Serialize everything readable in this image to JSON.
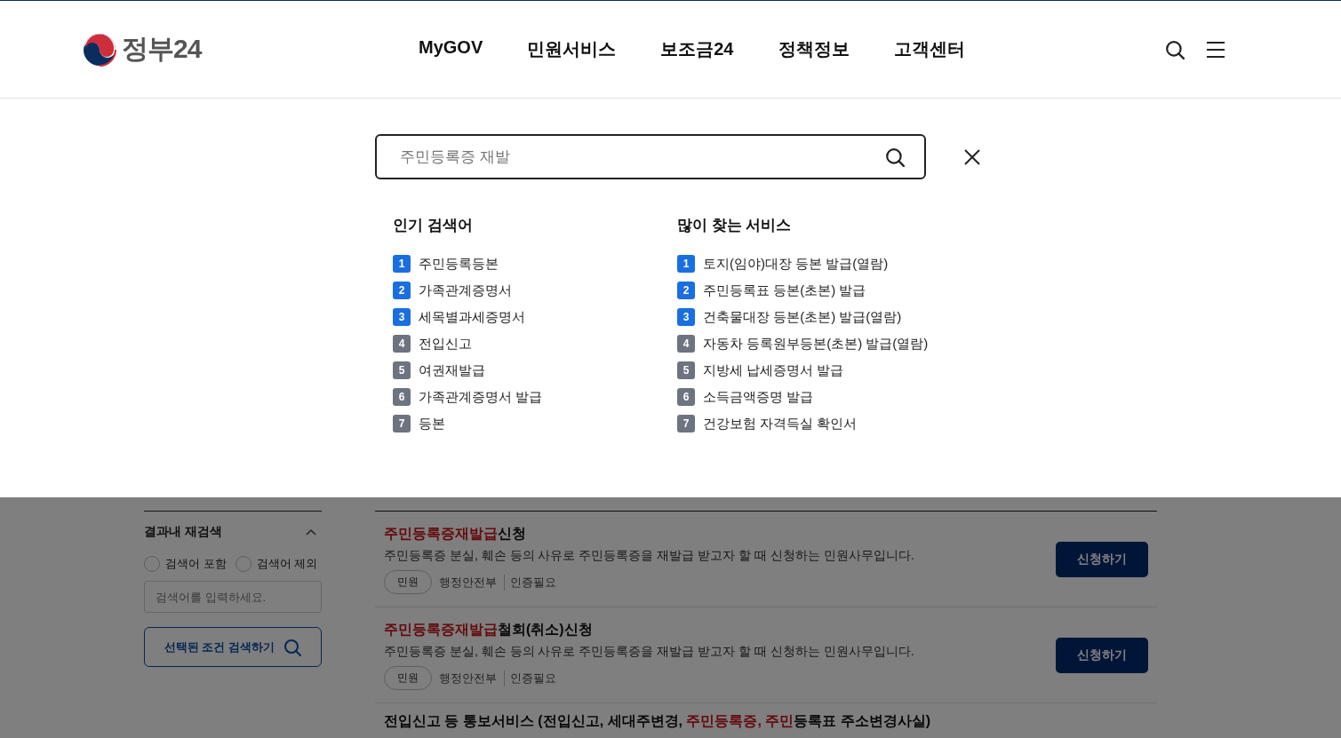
{
  "header": {
    "logo": "정부24",
    "nav": [
      {
        "label": "MyGOV"
      },
      {
        "label": "민원서비스"
      },
      {
        "label": "보조금24"
      },
      {
        "label": "정책정보"
      },
      {
        "label": "고객센터"
      }
    ]
  },
  "search": {
    "placeholder": "주민등록증 재발"
  },
  "popular": {
    "title": "인기 검색어",
    "items": [
      {
        "rank": "1",
        "label": "주민등록등본",
        "color": "#1a6fe0"
      },
      {
        "rank": "2",
        "label": "가족관계증명서",
        "color": "#1a6fe0"
      },
      {
        "rank": "3",
        "label": "세목별과세증명서",
        "color": "#1a6fe0"
      },
      {
        "rank": "4",
        "label": "전입신고",
        "color": "#6d7380"
      },
      {
        "rank": "5",
        "label": "여권재발급",
        "color": "#6d7380"
      },
      {
        "rank": "6",
        "label": "가족관계증명서 발급",
        "color": "#6d7380"
      },
      {
        "rank": "7",
        "label": "등본",
        "color": "#6d7380"
      }
    ]
  },
  "services": {
    "title": "많이 찾는 서비스",
    "items": [
      {
        "rank": "1",
        "label": "토지(임야)대장 등본 발급(열람)",
        "color": "#1a6fe0"
      },
      {
        "rank": "2",
        "label": "주민등록표 등본(초본) 발급",
        "color": "#1a6fe0"
      },
      {
        "rank": "3",
        "label": "건축물대장 등본(초본) 발급(열람)",
        "color": "#1a6fe0"
      },
      {
        "rank": "4",
        "label": "자동차 등록원부등본(초본) 발급(열람)",
        "color": "#6d7380"
      },
      {
        "rank": "5",
        "label": "지방세 납세증명서 발급",
        "color": "#6d7380"
      },
      {
        "rank": "6",
        "label": "소득금액증명 발급",
        "color": "#6d7380"
      },
      {
        "rank": "7",
        "label": "건강보험 자격득실 확인서",
        "color": "#6d7380"
      }
    ]
  },
  "filter": {
    "title": "결과내 재검색",
    "expanded": true,
    "options": [
      {
        "label": "검색어 포함",
        "selected": false
      },
      {
        "label": "검색어 제외",
        "selected": false
      }
    ],
    "placeholder": "검색어를 입력하세요.",
    "button": "선택된 조건 검색하기"
  },
  "results": [
    {
      "title": [
        {
          "text": "주민등록증재발급",
          "highlight": true
        },
        {
          "text": "신청",
          "highlight": false
        }
      ],
      "description": "주민등록증 분실, 훼손 등의 사유로 주민등록증을 재발급 받고자 할 때 신청하는 민원사무입니다.",
      "tag": "민원",
      "org": "행정안전부",
      "auth": "인증필요",
      "button": "신청하기"
    },
    {
      "title": [
        {
          "text": "주민등록증재발급",
          "highlight": true
        },
        {
          "text": "철회(취소)신청",
          "highlight": false
        }
      ],
      "description": "주민등록증 분실, 훼손 등의 사유로 주민등록증을 재발급 받고자 할 때 신청하는 민원사무입니다.",
      "tag": "민원",
      "org": "행정안전부",
      "auth": "인증필요",
      "button": "신청하기"
    },
    {
      "title": [
        {
          "text": "전입신고 등 통보서비스 (전입신고, 세대주변경, ",
          "highlight": false
        },
        {
          "text": "주민등록증, 주민",
          "highlight": true
        },
        {
          "text": "등록표 주소변경사실)",
          "highlight": false
        }
      ]
    }
  ]
}
